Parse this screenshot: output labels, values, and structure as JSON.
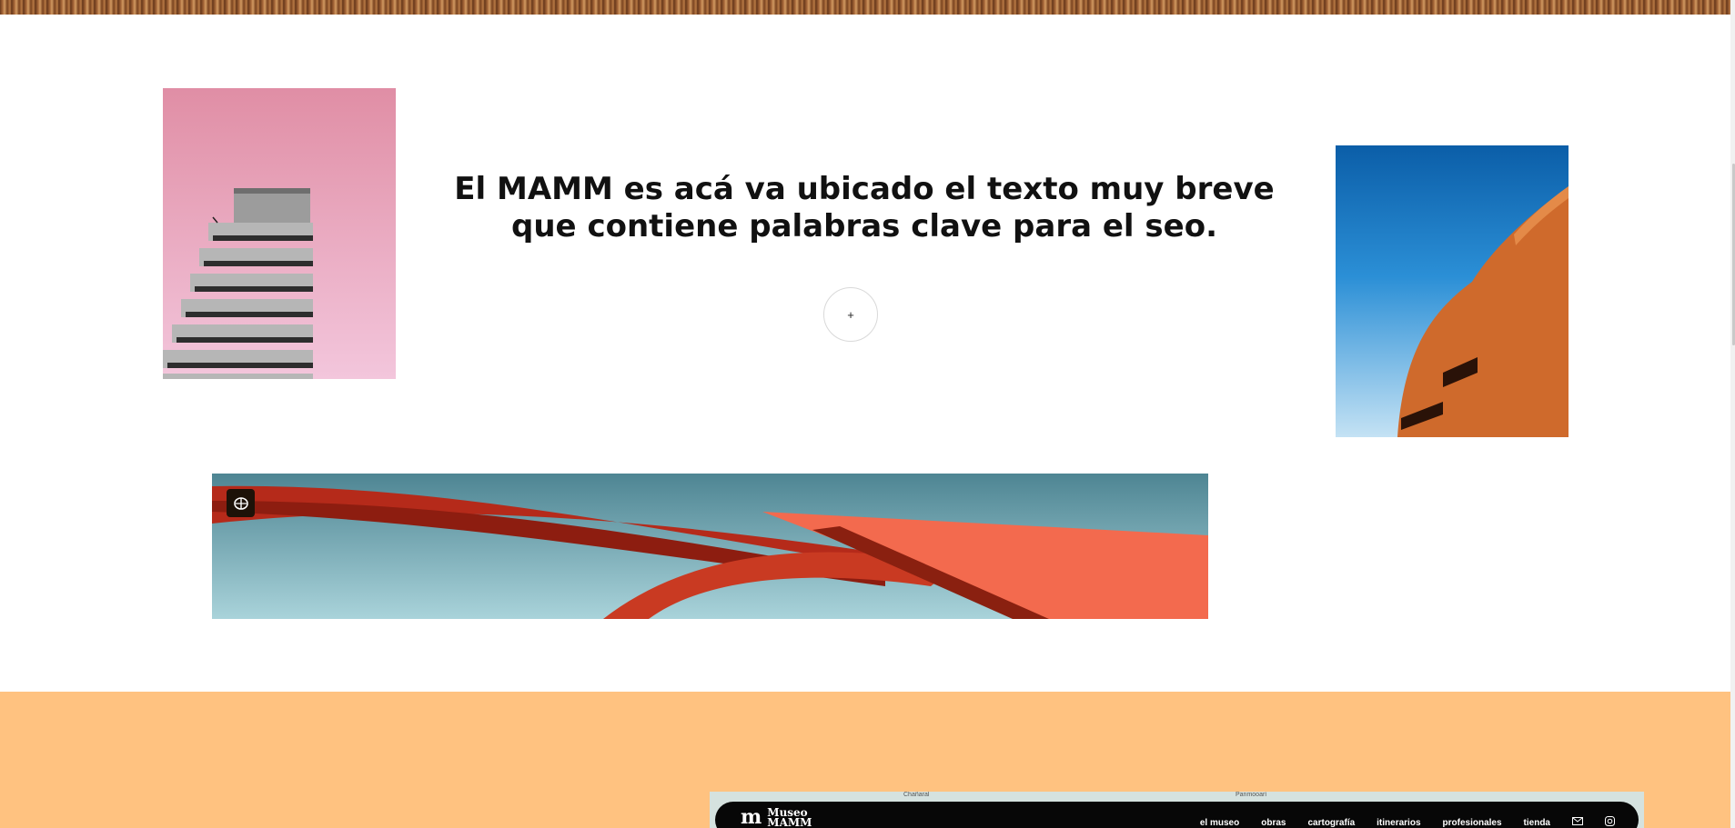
{
  "intro": {
    "headline": "El MAMM es acá va ubicado el texto muy breve que contiene palabras clave para el seo.",
    "more_button_label": "+"
  },
  "images": {
    "left": "pink-tower-photo",
    "right": "orange-brick-building-photo",
    "banner": "red-steel-sculpture-photo"
  },
  "banner": {
    "badge_icon": "brain-icon"
  },
  "map_section": {
    "background_color": "#ffc280",
    "map_labels": [
      "Chañaral",
      "Panmooarí"
    ],
    "navbar": {
      "logo_mark": "m",
      "logo_line1": "Museo",
      "logo_line2": "MAMM",
      "links": [
        "el museo",
        "obras",
        "cartografía",
        "itinerarios",
        "profesionales",
        "tienda"
      ],
      "icons": [
        "mail-icon",
        "instagram-icon"
      ]
    }
  }
}
